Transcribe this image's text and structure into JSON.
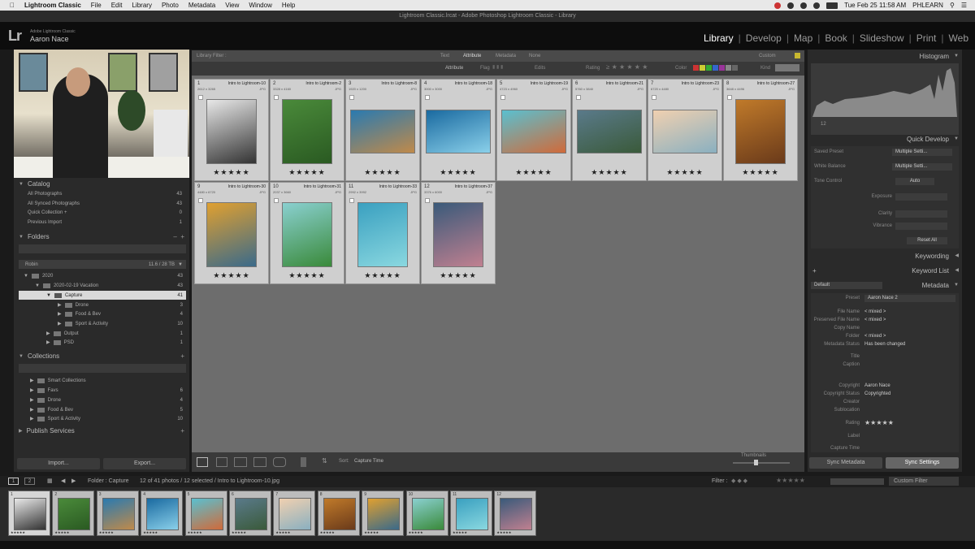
{
  "menubar": {
    "apple": "",
    "app": "Lightroom Classic",
    "items": [
      "File",
      "Edit",
      "Library",
      "Photo",
      "Metadata",
      "View",
      "Window",
      "Help"
    ],
    "clock": "Tue Feb 25  11:58 AM",
    "user": "PHLEARN"
  },
  "window_title": "Lightroom Classic.lrcat - Adobe Photoshop Lightroom Classic - Library",
  "identity": {
    "logo": "Lr",
    "product": "Adobe Lightroom Classic",
    "user": "Aaron Nace"
  },
  "modules": [
    "Library",
    "Develop",
    "Map",
    "Book",
    "Slideshow",
    "Print",
    "Web"
  ],
  "active_module": "Library",
  "left": {
    "catalog": {
      "title": "Catalog",
      "items": [
        {
          "label": "All Photographs",
          "count": "43"
        },
        {
          "label": "All Synced Photographs",
          "count": "43"
        },
        {
          "label": "Quick Collection +",
          "count": "0"
        },
        {
          "label": "Previous Import",
          "count": "1"
        }
      ]
    },
    "folders": {
      "title": "Folders",
      "volume": "Robin",
      "volume_size": "11.6 / 28 TB",
      "items": [
        {
          "label": "2020",
          "count": "43"
        },
        {
          "label": "2020-02-19 Vacation",
          "count": "43"
        },
        {
          "label": "Capture",
          "count": "41"
        },
        {
          "label": "Drone",
          "count": "3"
        },
        {
          "label": "Food & Bev",
          "count": "4"
        },
        {
          "label": "Sport & Activity",
          "count": "10"
        },
        {
          "label": "Output",
          "count": "1"
        },
        {
          "label": "PSD",
          "count": "1"
        }
      ]
    },
    "collections": {
      "title": "Collections",
      "items": [
        {
          "label": "Smart Collections",
          "count": ""
        },
        {
          "label": "Favs",
          "count": "6"
        },
        {
          "label": "Drone",
          "count": "4"
        },
        {
          "label": "Food & Bev",
          "count": "5"
        },
        {
          "label": "Sport & Activity",
          "count": "10"
        }
      ]
    },
    "publish": {
      "title": "Publish Services"
    },
    "import_label": "Import...",
    "export_label": "Export..."
  },
  "center": {
    "filter_title": "Library Filter :",
    "filter_tabs": [
      "Text",
      "Attribute",
      "Metadata",
      "None"
    ],
    "filter_preset": "Custom",
    "attribute_label": "Attribute",
    "flag_label": "Flag",
    "edits_label": "Edits",
    "rating_label": "Rating",
    "color_label": "Color",
    "kind_label": "Kind",
    "cells": [
      {
        "n": "1",
        "name": "Intro to Lightroom-10",
        "dim": "2612 x 3265",
        "ft": "JPG",
        "c1": "#e8e8e8",
        "c2": "#333333"
      },
      {
        "n": "2",
        "name": "Intro to Lightroom-2",
        "dim": "3328 x 4160",
        "ft": "JPG",
        "c1": "#4a8a3a",
        "c2": "#2a5a22"
      },
      {
        "n": "3",
        "name": "Intro to Lightroom-8",
        "dim": "1920 x 1200",
        "ft": "JPG",
        "c1": "#2a7ab0",
        "c2": "#c08a4a"
      },
      {
        "n": "4",
        "name": "Intro to Lightroom-18",
        "dim": "3000 x 3000",
        "ft": "JPG",
        "c1": "#1a6aa0",
        "c2": "#8ad0ea"
      },
      {
        "n": "5",
        "name": "Intro to Lightroom-19",
        "dim": "4723 x 4960",
        "ft": "JPG",
        "c1": "#5ac0d0",
        "c2": "#d06a3a"
      },
      {
        "n": "6",
        "name": "Intro to Lightroom-21",
        "dim": "5760 x 3840",
        "ft": "JPG",
        "c1": "#5a7a8a",
        "c2": "#3a5a3a"
      },
      {
        "n": "7",
        "name": "Intro to Lightroom-23",
        "dim": "6720 x 4480",
        "ft": "JPG",
        "c1": "#f0d0b0",
        "c2": "#8ab0c0"
      },
      {
        "n": "8",
        "name": "Intro to Lightroom-27",
        "dim": "3648 x 4496",
        "ft": "JPG",
        "c1": "#c07a2a",
        "c2": "#6a3a1a"
      },
      {
        "n": "9",
        "name": "Intro to Lightroom-30",
        "dim": "4480 x 6720",
        "ft": "JPG",
        "c1": "#e0a030",
        "c2": "#3a6a8a"
      },
      {
        "n": "10",
        "name": "Intro to Lightroom-31",
        "dim": "2037 x 3660",
        "ft": "JPG",
        "c1": "#8ad0d0",
        "c2": "#3a8a3a"
      },
      {
        "n": "11",
        "name": "Intro to Lightroom-33",
        "dim": "2992 x 3992",
        "ft": "JPG",
        "c1": "#3aa0c0",
        "c2": "#8ad8e0"
      },
      {
        "n": "12",
        "name": "Intro to Lightroom-37",
        "dim": "3376 x 6000",
        "ft": "JPG",
        "c1": "#3a5a7a",
        "c2": "#c08090"
      }
    ],
    "stars": "★★★★★",
    "sort_label": "Sort:",
    "sort_value": "Capture Time",
    "thumbnails_label": "Thumbnails"
  },
  "right": {
    "histogram": "Histogram",
    "histo_info": "12",
    "quick_develop": "Quick Develop",
    "saved_preset": "Saved Preset",
    "saved_preset_value": "Multiple Setti...",
    "white_balance": "White Balance",
    "white_balance_value": "Multiple Setti...",
    "tone_control": "Tone Control",
    "auto": "Auto",
    "exposure": "Exposure",
    "clarity": "Clarity",
    "vibrance": "Vibrance",
    "reset_all": "Reset All",
    "keywording": "Keywording",
    "keyword_list": "Keyword List",
    "metadata": "Metadata",
    "default": "Default",
    "preset": "Preset",
    "preset_value": "Aaron Nace 2",
    "meta_rows": [
      {
        "label": "File Name",
        "value": "< mixed >"
      },
      {
        "label": "Preserved File Name",
        "value": "< mixed >"
      },
      {
        "label": "Copy Name",
        "value": ""
      },
      {
        "label": "Folder",
        "value": "< mixed >"
      },
      {
        "label": "Metadata Status",
        "value": "Has been changed"
      },
      {
        "label": "Title",
        "value": ""
      },
      {
        "label": "Caption",
        "value": ""
      },
      {
        "label": "Copyright",
        "value": "Aaron Nace"
      },
      {
        "label": "Copyright Status",
        "value": "Copyrighted"
      },
      {
        "label": "Creator",
        "value": ""
      },
      {
        "label": "Sublocation",
        "value": ""
      },
      {
        "label": "Rating",
        "value": "★★★★★"
      },
      {
        "label": "Label",
        "value": ""
      },
      {
        "label": "Capture Time",
        "value": ""
      }
    ],
    "sync_metadata": "Sync Metadata",
    "sync_settings": "Sync Settings"
  },
  "filmbar": {
    "page1": "1",
    "page2": "2",
    "folder": "Folder : Capture",
    "count": "12 of 41 photos / 12 selected / Intro to Lightroom-10.jpg",
    "filter_label": "Filter :",
    "custom_filter": "Custom Filter"
  },
  "colors": {
    "accent": "#ffffff",
    "panel": "#2a2a2a",
    "grid_bg": "#6d6d6d",
    "cell_bg": "#cfcfcf"
  }
}
